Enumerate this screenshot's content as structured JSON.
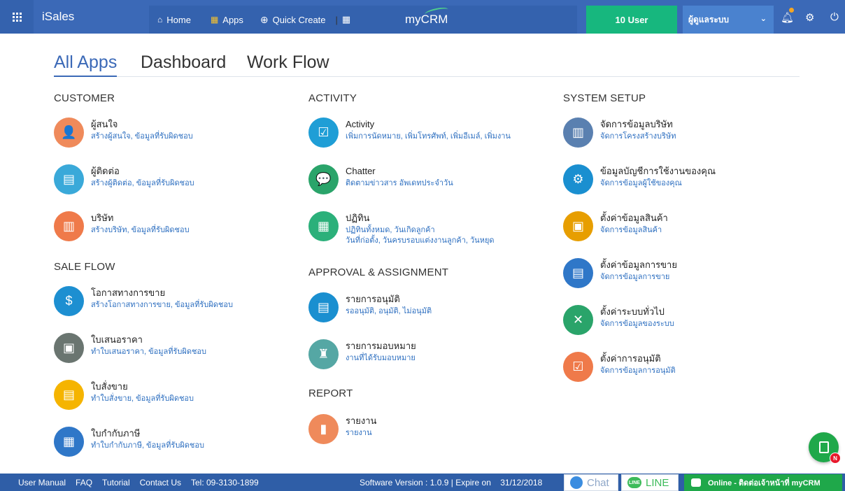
{
  "topbar": {
    "brand": "iSales",
    "nav": [
      {
        "icon": "home-icon",
        "glyph": "⌂",
        "label": "Home"
      },
      {
        "icon": "apps-icon",
        "glyph": "▦",
        "label": "Apps"
      },
      {
        "icon": "plus-circle-icon",
        "glyph": "⊕",
        "label": "Quick Create"
      }
    ],
    "separator": "|",
    "logo": "myCRM",
    "user_count": "10 User",
    "user_role": "ผู้ดูแลระบบ",
    "colors": {
      "bar": "#3b69b7",
      "nav": "#3462ae",
      "users": "#17b77e",
      "role": "#4a82cf"
    }
  },
  "tabs": [
    {
      "label": "All Apps",
      "active": true
    },
    {
      "label": "Dashboard",
      "active": false
    },
    {
      "label": "Work Flow",
      "active": false
    }
  ],
  "sections": {
    "customer": "CUSTOMER",
    "sale_flow": "SALE FLOW",
    "activity": "ACTIVITY",
    "approval": "APPROVAL & ASSIGNMENT",
    "report": "REPORT",
    "system_setup": "SYSTEM SETUP"
  },
  "apps": {
    "customer": [
      {
        "title": "ผู้สนใจ",
        "sub": "สร้างผู้สนใจ, ข้อมูลที่รับผิดชอบ",
        "color": "#ef8a5b",
        "icon": "user-icon",
        "glyph": "👤"
      },
      {
        "title": "ผู้ติดต่อ",
        "sub": "สร้างผู้ติดต่อ, ข้อมูลที่รับผิดชอบ",
        "color": "#3aa9d9",
        "icon": "contact-card-icon",
        "glyph": "▤"
      },
      {
        "title": "บริษัท",
        "sub": "สร้างบริษัท, ข้อมูลที่รับผิดชอบ",
        "color": "#ef7a4a",
        "icon": "building-icon",
        "glyph": "▥"
      }
    ],
    "sale_flow": [
      {
        "title": "โอกาสทางการขาย",
        "sub": "สร้างโอกาสทางการขาย, ข้อมูลที่รับผิดชอบ",
        "color": "#1d8fd1",
        "icon": "hand-coin-icon",
        "glyph": "$"
      },
      {
        "title": "ใบเสนอราคา",
        "sub": "ทำใบเสนอราคา, ข้อมูลที่รับผิดชอบ",
        "color": "#6a7570",
        "icon": "clipboard-icon",
        "glyph": "▣"
      },
      {
        "title": "ใบสั่งขาย",
        "sub": "ทำใบสั่งขาย, ข้อมูลที่รับผิดชอบ",
        "color": "#f5b400",
        "icon": "order-icon",
        "glyph": "▤"
      },
      {
        "title": "ใบกำกับภาษี",
        "sub": "ทำใบกำกับภาษี, ข้อมูลที่รับผิดชอบ",
        "color": "#2f77c8",
        "icon": "invoice-icon",
        "glyph": "▦"
      }
    ],
    "activity": [
      {
        "title": "Activity",
        "sub": "เพิ่มการนัดหมาย, เพิ่มโทรศัพท์, เพิ่มอีเมล์, เพิ่มงาน",
        "sub2": "",
        "color": "#1f9ed6",
        "icon": "calendar-check-icon",
        "glyph": "☑"
      },
      {
        "title": "Chatter",
        "sub": "ติดตามข่าวสาร อัพเดทประจำวัน",
        "sub2": "",
        "color": "#2aa46a",
        "icon": "chat-icon",
        "glyph": "💬"
      },
      {
        "title": "ปฏิทิน",
        "sub": "ปฏิทินทั้งหมด, วันเกิดลูกค้า",
        "sub2": "วันที่ก่อตั้ง, วันครบรอบแต่งงานลูกค้า, วันหยุด",
        "color": "#2bb07a",
        "icon": "calendar-icon",
        "glyph": "▦"
      }
    ],
    "approval": [
      {
        "title": "รายการอนุมัติ",
        "sub": "รออนุมัติ, อนุมัติ, ไม่อนุมัติ",
        "color": "#1a8fd0",
        "icon": "approval-icon",
        "glyph": "▤"
      },
      {
        "title": "รายการมอบหมาย",
        "sub": "งานที่ได้รับมอบหมาย",
        "color": "#55a7a4",
        "icon": "assign-icon",
        "glyph": "♜"
      }
    ],
    "report": [
      {
        "title": "รายงาน",
        "sub": "รายงาน",
        "color": "#ef8a5b",
        "icon": "bar-chart-icon",
        "glyph": "▮"
      }
    ],
    "system_setup": [
      {
        "title": "จัดการข้อมูลบริษัท",
        "sub": "จัดการโครงสร้างบริษัท",
        "color": "#5a80b0",
        "icon": "office-icon",
        "glyph": "▥"
      },
      {
        "title": "ข้อมูลบัญชีการใช้งานของคุณ",
        "sub": "จัดการข้อมูลผู้ใช้ของคุณ",
        "color": "#1a8fd0",
        "icon": "gear-icon",
        "glyph": "⚙"
      },
      {
        "title": "ตั้งค่าข้อมูลสินค้า",
        "sub": "จัดการข้อมูลสินค้า",
        "color": "#e79e00",
        "icon": "box-icon",
        "glyph": "▣"
      },
      {
        "title": "ตั้งค่าข้อมูลการขาย",
        "sub": "จัดการข้อมูลการขาย",
        "color": "#2f77c8",
        "icon": "sales-settings-icon",
        "glyph": "▤"
      },
      {
        "title": "ตั้งค่าระบบทั่วไป",
        "sub": "จัดการข้อมูลของระบบ",
        "color": "#2aa46a",
        "icon": "tools-icon",
        "glyph": "✕"
      },
      {
        "title": "ตั้งค่าการอนุมัติ",
        "sub": "จัดการข้อมูลการอนุมัติ",
        "color": "#ef7a4a",
        "icon": "approval-settings-icon",
        "glyph": "☑"
      }
    ]
  },
  "footer": {
    "links": [
      "User Manual",
      "FAQ",
      "Tutorial",
      "Contact Us",
      "Tel: 09-3130-1899"
    ],
    "version": "Software Version : 1.0.9 | Expire on    31/12/2018",
    "chat": "Chat",
    "line": "LINE",
    "line_badge": "LINE",
    "online": "Online - ติดต่อเจ้าหน้าที่ myCRM",
    "fab_badge": "N"
  }
}
